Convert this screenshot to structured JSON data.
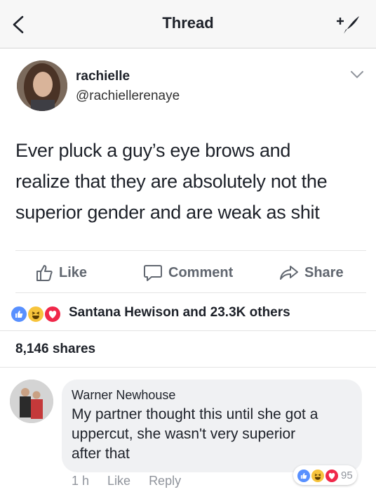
{
  "header": {
    "title": "Thread",
    "back_icon": "chevron-left-icon",
    "compose_icon": "compose-icon"
  },
  "post": {
    "author_name": "rachielle",
    "author_handle": "@rachiellerenaye",
    "text_lines": [
      "Ever pluck a guy’s eye brows and",
      "realize that they are absolutely not the",
      "superior gender and are weak as shit"
    ]
  },
  "actions": {
    "like": "Like",
    "comment": "Comment",
    "share": "Share"
  },
  "reactions": {
    "summary": "Santana Hewison and 23.3K others"
  },
  "shares": "8,146 shares",
  "comment": {
    "author": "Warner Newhouse",
    "text_lines": [
      "My partner thought this until she got a",
      "uppercut, she wasn't very superior",
      "after that"
    ],
    "time": "1 h",
    "like_label": "Like",
    "reply_label": "Reply",
    "reaction_count": "95"
  },
  "colors": {
    "like_blue": "#5890ff",
    "haha_yellow": "#f7c43c",
    "love_red": "#f0284a",
    "meta_grey": "#90949c",
    "bubble_grey": "#f0f1f3"
  }
}
